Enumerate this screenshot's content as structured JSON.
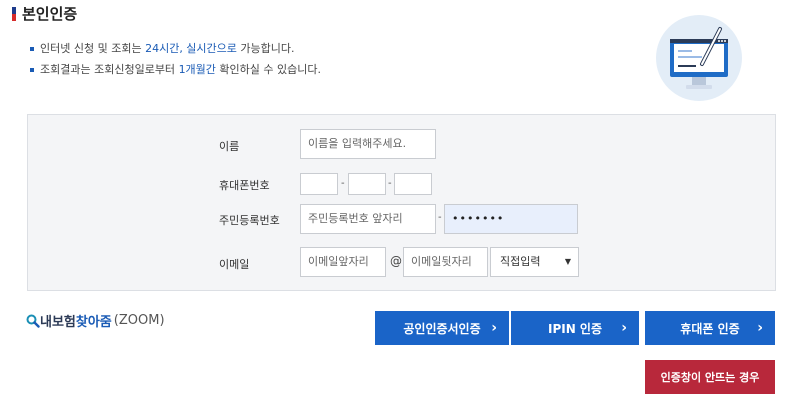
{
  "header": {
    "title": "본인인증"
  },
  "notes": {
    "line1_pre": "인터넷 신청 및 조회는 ",
    "line1_hl": "24시간, 실시간으로",
    "line1_post": " 가능합니다.",
    "line2_pre": "조회결과는 조회신청일로부터 ",
    "line2_hl": "1개월간",
    "line2_post": " 확인하실 수 있습니다."
  },
  "form": {
    "name_label": "이름",
    "name_placeholder": "이름을 입력해주세요.",
    "phone_label": "휴대폰번호",
    "phone_sep": "-",
    "rrn_label": "주민등록번호",
    "rrn_front_placeholder": "주민등록번호 앞자리",
    "rrn_sep": "-",
    "rrn_back_value": "•••••••",
    "email_label": "이메일",
    "email_local_placeholder": "이메일앞자리",
    "email_at": "@",
    "email_domain_placeholder": "이메일뒷자리",
    "email_select_value": "직접입력"
  },
  "zoom": {
    "icon": "search-icon",
    "part1": "내보험 ",
    "part2": "찾아줌",
    "part3": "(ZOOM)"
  },
  "buttons": {
    "cert": "공인인증서인증",
    "ipin": "IPIN 인증",
    "phone": "휴대폰 인증",
    "help": "인증창이 안뜨는 경우",
    "chevron": "›"
  },
  "colors": {
    "accent": "#1a64c8",
    "danger": "#b8283b",
    "form_bg": "#f4f5f7"
  }
}
